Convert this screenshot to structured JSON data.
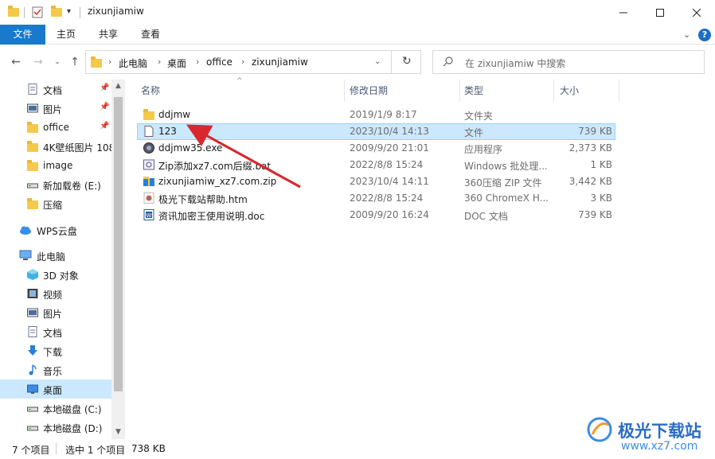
{
  "window": {
    "title": "zixunjiamiw",
    "minimize_icon": "minimize-icon",
    "maximize_icon": "maximize-icon",
    "close_icon": "close-icon"
  },
  "ribbon": {
    "tabs": [
      {
        "label": "文件"
      },
      {
        "label": "主页"
      },
      {
        "label": "共享"
      },
      {
        "label": "查看"
      }
    ]
  },
  "address": {
    "crumbs": [
      "此电脑",
      "桌面",
      "office",
      "zixunjiamiw"
    ],
    "search_placeholder": "在 zixunjiamiw 中搜索"
  },
  "nav": {
    "items": [
      {
        "label": "文档",
        "icon": "document-icon",
        "pinned": true
      },
      {
        "label": "图片",
        "icon": "pictures-icon",
        "pinned": true
      },
      {
        "label": "office",
        "icon": "folder-icon",
        "pinned": true
      },
      {
        "label": "4K壁纸图片 108",
        "icon": "folder-icon",
        "pinned": false
      },
      {
        "label": "image",
        "icon": "folder-icon",
        "pinned": false
      },
      {
        "label": "新加载卷 (E:)",
        "icon": "drive-icon",
        "pinned": false
      },
      {
        "label": "压缩",
        "icon": "folder-icon",
        "pinned": false
      },
      {
        "label": "WPS云盘",
        "icon": "cloud-icon",
        "pinned": false
      },
      {
        "label": "此电脑",
        "icon": "computer-icon",
        "pinned": false
      },
      {
        "label": "3D 对象",
        "icon": "3d-objects-icon",
        "pinned": false
      },
      {
        "label": "视频",
        "icon": "video-icon",
        "pinned": false
      },
      {
        "label": "图片",
        "icon": "pictures-icon",
        "pinned": false
      },
      {
        "label": "文档",
        "icon": "document-icon",
        "pinned": false
      },
      {
        "label": "下载",
        "icon": "download-icon",
        "pinned": false
      },
      {
        "label": "音乐",
        "icon": "music-icon",
        "pinned": false
      },
      {
        "label": "桌面",
        "icon": "desktop-icon",
        "pinned": false
      },
      {
        "label": "本地磁盘 (C:)",
        "icon": "drive-icon",
        "pinned": false
      },
      {
        "label": "本地磁盘 (D:)",
        "icon": "drive-icon",
        "pinned": false
      }
    ]
  },
  "columns": {
    "name": "名称",
    "date": "修改日期",
    "type": "类型",
    "size": "大小"
  },
  "files": [
    {
      "name": "ddjmw",
      "date": "2019/1/9 8:17",
      "type": "文件夹",
      "size": "",
      "icon": "folder-icon"
    },
    {
      "name": "123",
      "date": "2023/10/4 14:13",
      "type": "文件",
      "size": "739 KB",
      "icon": "file-icon"
    },
    {
      "name": "ddjmw35.exe",
      "date": "2009/9/20 21:01",
      "type": "应用程序",
      "size": "2,373 KB",
      "icon": "exe-icon"
    },
    {
      "name": "Zip添加xz7.com后缀.bat",
      "date": "2022/8/8 15:24",
      "type": "Windows 批处理...",
      "size": "1 KB",
      "icon": "bat-icon"
    },
    {
      "name": "zixunjiamiw_xz7.com.zip",
      "date": "2023/10/4 14:11",
      "type": "360压缩 ZIP 文件",
      "size": "3,442 KB",
      "icon": "zip-icon"
    },
    {
      "name": "极光下载站帮助.htm",
      "date": "2022/8/8 15:24",
      "type": "360 ChromeX H...",
      "size": "3 KB",
      "icon": "htm-icon"
    },
    {
      "name": "资讯加密王使用说明.doc",
      "date": "2009/9/20 16:24",
      "type": "DOC 文档",
      "size": "739 KB",
      "icon": "doc-icon"
    }
  ],
  "status": {
    "count": "7 个项目",
    "selected": "选中 1 个项目",
    "size": "738 KB"
  },
  "watermark": {
    "brand": "极光下载站",
    "url": "www.xz7.com"
  },
  "colors": {
    "accent": "#1979ca",
    "selection": "#cce8ff",
    "arrow": "#d9272e"
  }
}
